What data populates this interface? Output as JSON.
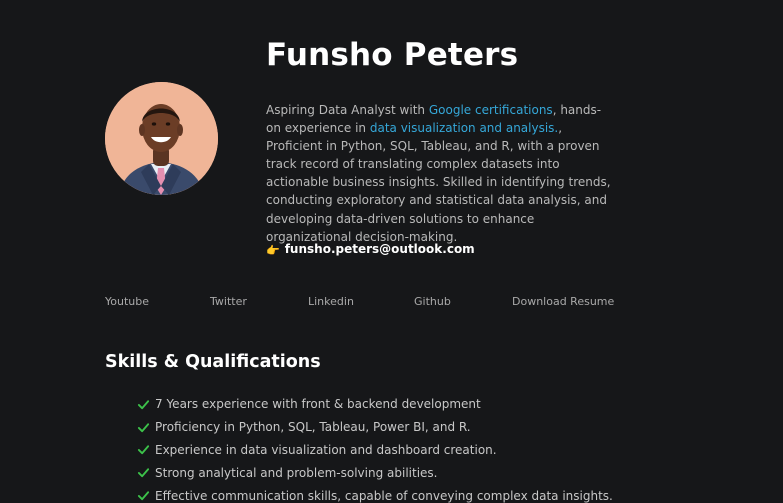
{
  "profile": {
    "name": "Funsho Peters",
    "bio": {
      "part1": "Aspiring Data Analyst with ",
      "link1": "Google certifications",
      "part2": ", hands-on experience in ",
      "link2": "data visualization and analysis.",
      "part3": ", Proficient in Python, SQL, Tableau, and R, with a proven track record of translating complex datasets into actionable business insights. Skilled in identifying trends, conducting exploratory and statistical data analysis, and developing data-driven solutions to enhance organizational decision-making."
    },
    "email_icon": "pointing-hand",
    "email": "funsho.peters@outlook.com"
  },
  "nav": {
    "items": [
      {
        "label": "Youtube"
      },
      {
        "label": "Twitter"
      },
      {
        "label": "Linkedin"
      },
      {
        "label": "Github"
      },
      {
        "label": "Download Resume"
      }
    ]
  },
  "skills": {
    "title": "Skills & Qualifications",
    "check_icon": "check-icon",
    "items": [
      "7 Years experience with front & backend development",
      "Proficiency in Python, SQL, Tableau, Power BI, and R.",
      "Experience in data visualization and dashboard creation.",
      "Strong analytical and problem-solving abilities.",
      "Effective communication skills, capable of conveying complex data insights."
    ]
  },
  "colors": {
    "background": "#161719",
    "link": "#35a7d8",
    "check": "#3cc24a",
    "heading": "#ffffff"
  }
}
